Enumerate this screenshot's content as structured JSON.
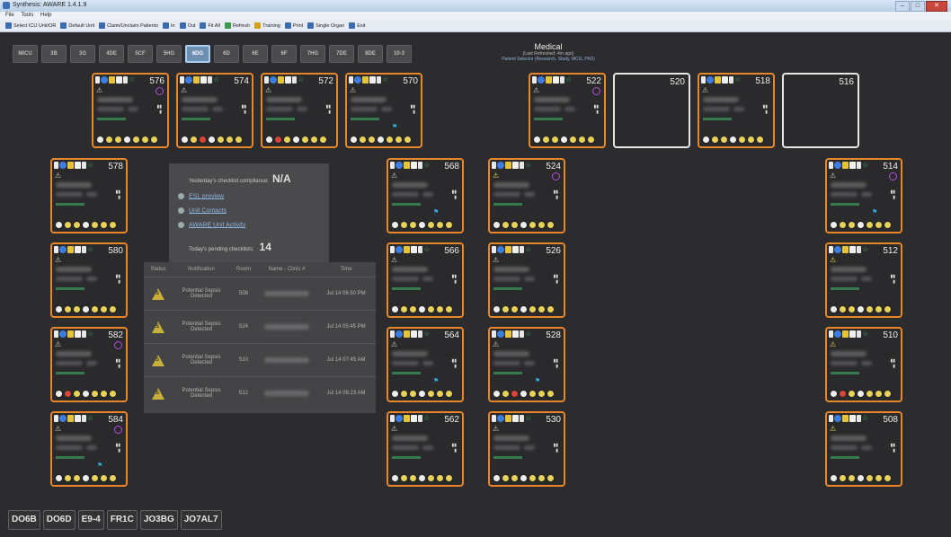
{
  "window": {
    "title": "Synthesis: AWARE 1.4.1.9",
    "buttons": [
      "–",
      "□",
      "✕"
    ]
  },
  "menu": [
    "File",
    "Tools",
    "Help"
  ],
  "toolbar": [
    {
      "label": "Select ICU Unit/OR",
      "icon": "grid-icon",
      "color": "b"
    },
    {
      "label": "Default Unit",
      "icon": "home-icon",
      "color": "b"
    },
    {
      "label": "Claim/Unclaim Patients",
      "icon": "person-icon",
      "color": "b"
    },
    {
      "label": "In",
      "icon": "user-in-icon",
      "color": "b"
    },
    {
      "label": "Out",
      "icon": "user-out-icon",
      "color": "b"
    },
    {
      "label": "Fit All",
      "icon": "fit-icon",
      "color": "b"
    },
    {
      "label": "Refresh",
      "icon": "refresh-icon",
      "color": "g"
    },
    {
      "label": "Training",
      "icon": "training-icon",
      "color": "y"
    },
    {
      "label": "Print",
      "icon": "print-icon",
      "color": "b"
    },
    {
      "label": "Single Organ",
      "icon": "organ-icon",
      "color": "b"
    },
    {
      "label": "Exit",
      "icon": "exit-icon",
      "color": "b"
    }
  ],
  "unit_tabs": [
    "MICU",
    "3B",
    "3G",
    "4DE",
    "5CF",
    "5HG",
    "6DG",
    "6D",
    "6E",
    "6F",
    "7HG",
    "7DE",
    "8DE",
    "10-3"
  ],
  "selected_unit_tab": "6DG",
  "unit": {
    "name": "Medical",
    "refreshed": "(Last Refreshed: 4m ago)",
    "detail": "Patient Selector (Research, Study, MCG, PhD)"
  },
  "beds": [
    {
      "num": "576"
    },
    {
      "num": "574"
    },
    {
      "num": "572"
    },
    {
      "num": "570"
    },
    {
      "num": "522"
    },
    {
      "num": "520"
    },
    {
      "num": "518"
    },
    {
      "num": "516"
    },
    {
      "num": "578"
    },
    {
      "num": "580"
    },
    {
      "num": "582"
    },
    {
      "num": "584"
    },
    {
      "num": "568"
    },
    {
      "num": "566"
    },
    {
      "num": "564"
    },
    {
      "num": "562"
    },
    {
      "num": "524"
    },
    {
      "num": "526"
    },
    {
      "num": "528"
    },
    {
      "num": "530"
    },
    {
      "num": "514"
    },
    {
      "num": "512"
    },
    {
      "num": "510"
    },
    {
      "num": "508"
    }
  ],
  "checklist": {
    "compliance_label": "Yesterday's checklist compliance:",
    "compliance_value": "N/A",
    "links": [
      "ESL preview",
      "Unit Contacts",
      "AWARE Unit Activity"
    ],
    "pending_label": "Today's pending checklists:",
    "pending_value": "14"
  },
  "notifications": {
    "headers": [
      "Status",
      "Notification",
      "Room",
      "Name - Clinic #",
      "Time"
    ],
    "rows": [
      {
        "status": "S",
        "notification": "Potential Sepsis Detected",
        "room": "508",
        "time": "Jul 14 06:50 PM"
      },
      {
        "status": "S",
        "notification": "Potential Sepsis Detected",
        "room": "524",
        "time": "Jul 14 05:45 PM"
      },
      {
        "status": "S",
        "notification": "Potential Sepsis Detected",
        "room": "510",
        "time": "Jul 14 07:45 AM"
      },
      {
        "status": "S",
        "notification": "Potential Sepsis Detected",
        "room": "512",
        "time": "Jul 14 06:23 AM"
      }
    ]
  },
  "bottom_tabs": [
    "DO6B",
    "DO6D",
    "E9-4",
    "FR1C",
    "JO3BG",
    "JO7AL7"
  ]
}
